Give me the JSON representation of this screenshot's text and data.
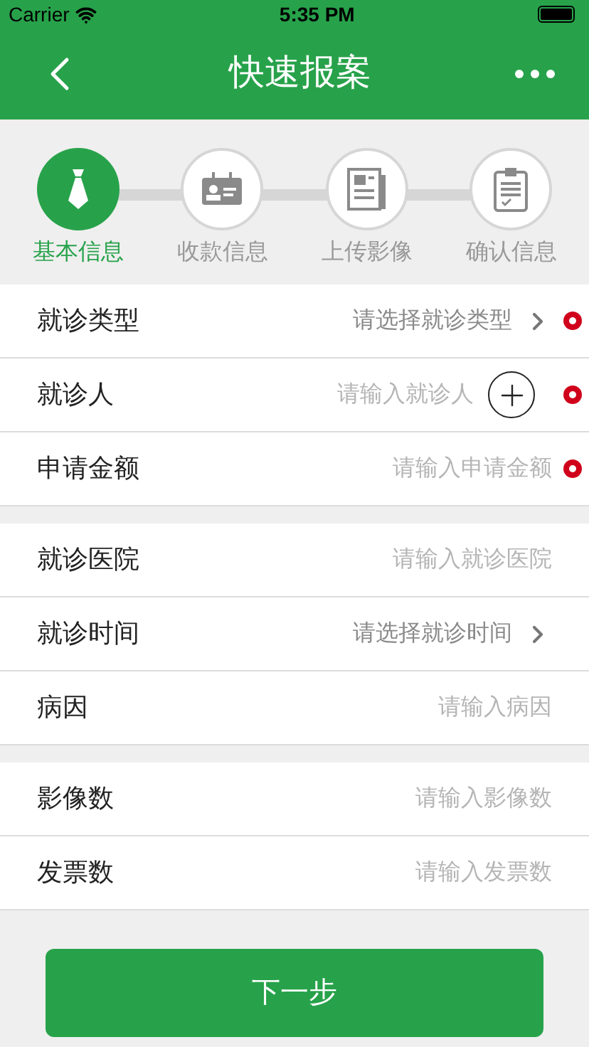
{
  "status_bar": {
    "carrier": "Carrier",
    "time": "5:35 PM"
  },
  "nav": {
    "title": "快速报案"
  },
  "steps": [
    {
      "label": "基本信息",
      "selected": true
    },
    {
      "label": "收款信息",
      "selected": false
    },
    {
      "label": "上传影像",
      "selected": false
    },
    {
      "label": "确认信息",
      "selected": false
    }
  ],
  "groups": [
    {
      "rows": [
        {
          "label": "就诊类型",
          "kind": "select",
          "placeholder": "请选择就诊类型",
          "required": true
        },
        {
          "label": "就诊人",
          "kind": "person",
          "placeholder": "请输入就诊人",
          "required": true
        },
        {
          "label": "申请金额",
          "kind": "input",
          "placeholder": "请输入申请金额",
          "required": true
        }
      ]
    },
    {
      "rows": [
        {
          "label": "就诊医院",
          "kind": "input",
          "placeholder": "请输入就诊医院",
          "required": false
        },
        {
          "label": "就诊时间",
          "kind": "select",
          "placeholder": "请选择就诊时间",
          "required": false
        },
        {
          "label": "病因",
          "kind": "input",
          "placeholder": "请输入病因",
          "required": false
        }
      ]
    },
    {
      "rows": [
        {
          "label": "影像数",
          "kind": "input",
          "placeholder": "请输入影像数",
          "required": false
        },
        {
          "label": "发票数",
          "kind": "input",
          "placeholder": "请输入发票数",
          "required": false
        }
      ]
    }
  ],
  "next_button": "下一步"
}
